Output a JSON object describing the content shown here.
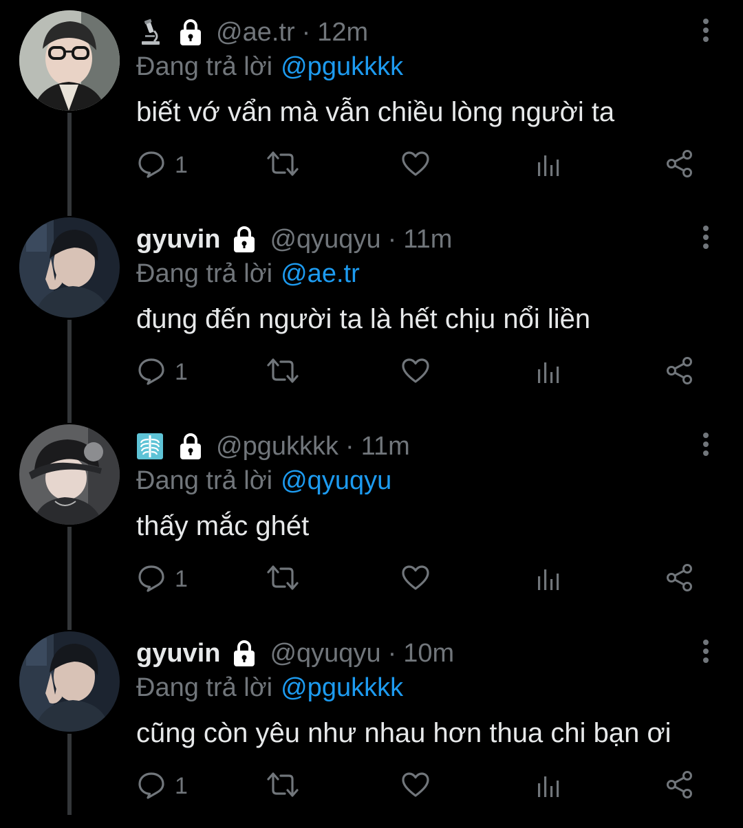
{
  "tweets": [
    {
      "display_name": "",
      "name_emoji": "microscope-icon",
      "handle": "@ae.tr",
      "separator": "·",
      "time": "12m",
      "reply_prefix": "Đang trả lời",
      "reply_to": "@pgukkkk",
      "text": "biết vớ vẩn mà vẫn chiều lòng người ta",
      "reply_count": "1"
    },
    {
      "display_name": "gyuvin",
      "name_emoji": "",
      "handle": "@qyuqyu",
      "separator": "·",
      "time": "11m",
      "reply_prefix": "Đang trả lời",
      "reply_to": "@ae.tr",
      "text": "đụng đến người ta là hết chịu nổi liền",
      "reply_count": "1"
    },
    {
      "display_name": "",
      "name_emoji": "x-ray-icon",
      "handle": "@pgukkkk",
      "separator": "·",
      "time": "11m",
      "reply_prefix": "Đang trả lời",
      "reply_to": "@qyuqyu",
      "text": "thấy mắc ghét",
      "reply_count": "1"
    },
    {
      "display_name": "gyuvin",
      "name_emoji": "",
      "handle": "@qyuqyu",
      "separator": "·",
      "time": "10m",
      "reply_prefix": "Đang trả lời",
      "reply_to": "@pgukkkk",
      "text": "cũng còn yêu như nhau hơn thua chi bạn ơi",
      "reply_count": "1"
    }
  ],
  "colors": {
    "background": "#000000",
    "primary_text": "#e7e9ea",
    "secondary_text": "#71767b",
    "accent": "#1d9bf0",
    "thread_line": "#333639"
  }
}
